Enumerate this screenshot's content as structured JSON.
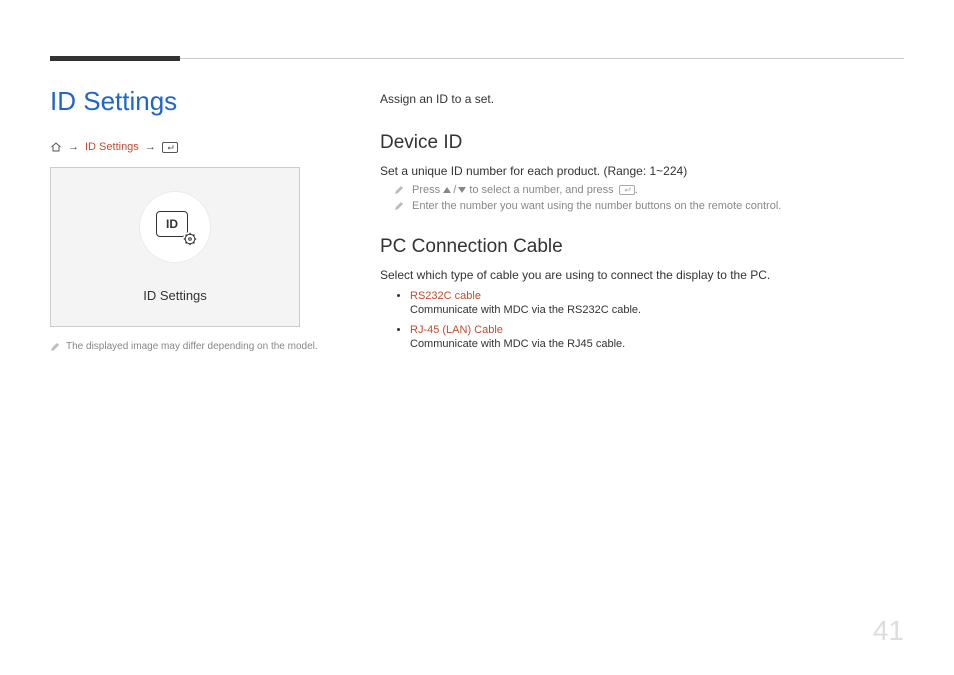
{
  "page": {
    "title": "ID Settings",
    "number": "41"
  },
  "breadcrumb": {
    "link": "ID Settings"
  },
  "preview": {
    "idLabel": "ID",
    "caption": "ID Settings"
  },
  "leftNote": "The displayed image may differ depending on the model.",
  "intro": "Assign an ID to a set.",
  "deviceId": {
    "heading": "Device ID",
    "desc": "Set a unique ID number for each product. (Range: 1~224)",
    "note1a": "Press",
    "note1b": "to select a number, and press",
    "note1c": ".",
    "note2": "Enter the number you want using the number buttons on the remote control."
  },
  "pcConn": {
    "heading": "PC Connection Cable",
    "desc": "Select which type of cable you are using to connect the display to the PC.",
    "options": [
      {
        "title": "RS232C cable",
        "desc": "Communicate with MDC via the RS232C cable."
      },
      {
        "title": "RJ-45 (LAN) Cable",
        "desc": "Communicate with MDC via the RJ45 cable."
      }
    ]
  }
}
